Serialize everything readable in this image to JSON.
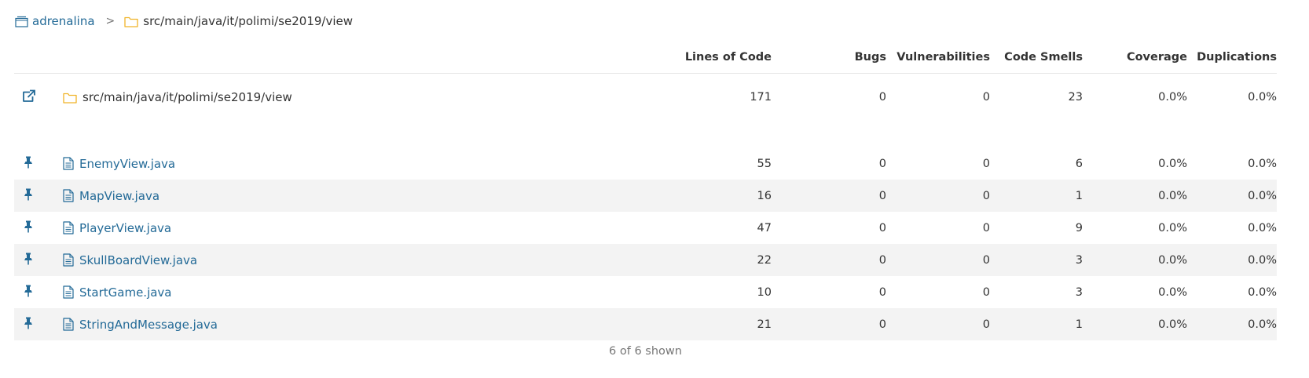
{
  "breadcrumb": {
    "project_icon": "project-icon",
    "project": "adrenalina",
    "separator": ">",
    "folder_icon": "folder-icon",
    "path": "src/main/java/it/polimi/se2019/view"
  },
  "columns": [
    "Lines of Code",
    "Bugs",
    "Vulnerabilities",
    "Code Smells",
    "Coverage",
    "Duplications"
  ],
  "base": {
    "action_icon": "open-external-icon",
    "icon": "folder-icon",
    "name": "src/main/java/it/polimi/se2019/view",
    "values": [
      "171",
      "0",
      "0",
      "23",
      "0.0%",
      "0.0%"
    ]
  },
  "files": [
    {
      "pin_icon": "pin-icon",
      "icon": "file-icon",
      "name": "EnemyView.java",
      "values": [
        "55",
        "0",
        "0",
        "6",
        "0.0%",
        "0.0%"
      ]
    },
    {
      "pin_icon": "pin-icon",
      "icon": "file-icon",
      "name": "MapView.java",
      "values": [
        "16",
        "0",
        "0",
        "1",
        "0.0%",
        "0.0%"
      ]
    },
    {
      "pin_icon": "pin-icon",
      "icon": "file-icon",
      "name": "PlayerView.java",
      "values": [
        "47",
        "0",
        "0",
        "9",
        "0.0%",
        "0.0%"
      ]
    },
    {
      "pin_icon": "pin-icon",
      "icon": "file-icon",
      "name": "SkullBoardView.java",
      "values": [
        "22",
        "0",
        "0",
        "3",
        "0.0%",
        "0.0%"
      ]
    },
    {
      "pin_icon": "pin-icon",
      "icon": "file-icon",
      "name": "StartGame.java",
      "values": [
        "10",
        "0",
        "0",
        "3",
        "0.0%",
        "0.0%"
      ]
    },
    {
      "pin_icon": "pin-icon",
      "icon": "file-icon",
      "name": "StringAndMessage.java",
      "values": [
        "21",
        "0",
        "0",
        "1",
        "0.0%",
        "0.0%"
      ]
    }
  ],
  "footer": "6 of 6 shown",
  "colors": {
    "link": "#236a97",
    "folder": "#f0b429",
    "striped_row": "#f3f3f3",
    "muted_text": "#777777"
  }
}
